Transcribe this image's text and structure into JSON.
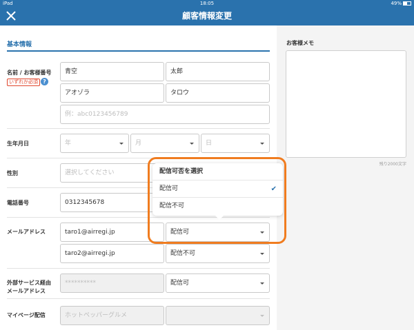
{
  "status_bar": {
    "device": "iPad",
    "time": "18:05",
    "battery": "49%"
  },
  "nav": {
    "title": "顧客情報変更"
  },
  "form": {
    "section_title": "基本情報",
    "name_row": {
      "label": "名前 / お客様番号",
      "required_badge": "いずれか必須",
      "last_name": "青空",
      "first_name": "太郎",
      "last_name_kana": "アオゾラ",
      "first_name_kana": "タロウ",
      "customer_number_placeholder": "例：abc0123456789"
    },
    "birthday_row": {
      "label": "生年月日",
      "year": "年",
      "month": "月",
      "day": "日"
    },
    "gender_row": {
      "label": "性別",
      "placeholder": "選択してください"
    },
    "phone_row": {
      "label": "電話番号",
      "value": "0312345678"
    },
    "email_row": {
      "label": "メールアドレス",
      "email1": "taro1@airregi.jp",
      "email1_delivery": "配信可",
      "email2": "taro2@airregi.jp",
      "email2_delivery": "配信不可"
    },
    "external_row": {
      "label_line1": "外部サービス経由",
      "label_line2": "メールアドレス",
      "masked_value": "**********",
      "delivery": "配信可"
    },
    "mypage_row": {
      "label": "マイページ配信",
      "service": "ホットペッパーグルメ"
    }
  },
  "memo": {
    "label": "お客様メモ",
    "counter": "残り2000文字"
  },
  "popover": {
    "title": "配信可否を選択",
    "options": [
      "配信可",
      "配信不可"
    ],
    "selected": "配信可"
  },
  "colors": {
    "brand": "#2a72ad",
    "required": "#e0452b",
    "highlight": "#f07c1f"
  }
}
